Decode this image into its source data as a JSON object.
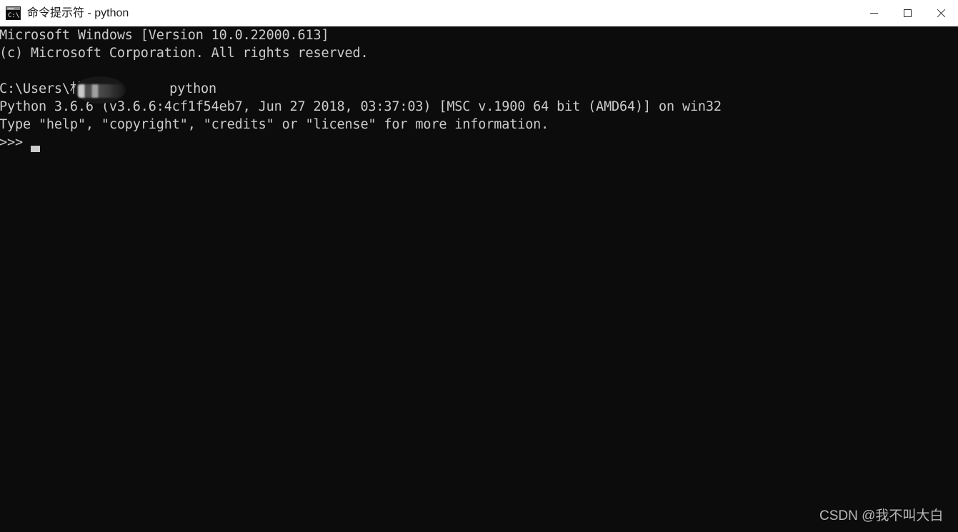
{
  "window": {
    "title": "命令提示符 - python",
    "icon": "cmd-console-icon",
    "controls": [
      {
        "name": "minimize",
        "glyph": "minimize-icon"
      },
      {
        "name": "maximize",
        "glyph": "maximize-icon"
      },
      {
        "name": "close",
        "glyph": "close-icon"
      }
    ],
    "titlebar_bg": "#ffffff",
    "titlebar_fg": "#1b1b1b"
  },
  "console": {
    "background": "#0c0c0c",
    "foreground": "#cccccc",
    "lines": [
      "Microsoft Windows [Version 10.0.22000.613]",
      "(c) Microsoft Corporation. All rights reserved.",
      "",
      "C:\\Users\\林           python",
      "Python 3.6.6 (v3.6.6:4cf1f54eb7, Jun 27 2018, 03:37:03) [MSC v.1900 64 bit (AMD64)] on win32",
      "Type \"help\", \"copyright\", \"credits\" or \"license\" for more information.",
      ">>> "
    ],
    "redaction": {
      "applies_to_line": 3,
      "note": "blurred username mosaic"
    },
    "cursor": {
      "shape": "block",
      "line": 6,
      "column": 4
    }
  },
  "watermark": {
    "text": "CSDN @我不叫大白",
    "color": "#b9b9b9"
  }
}
